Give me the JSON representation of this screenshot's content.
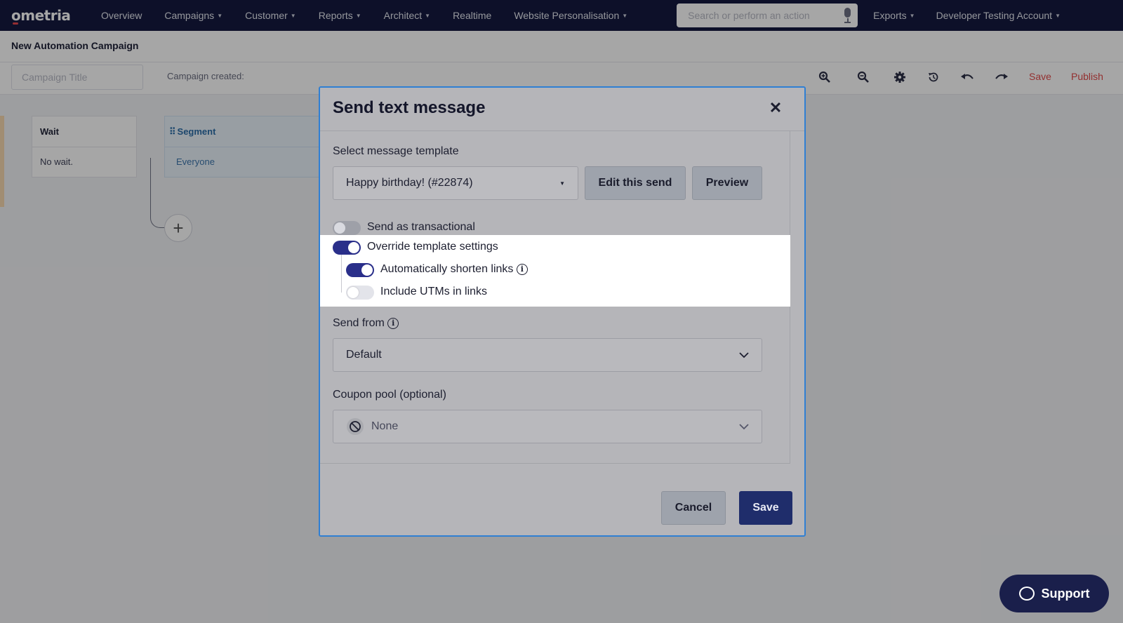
{
  "nav": {
    "logo": "ometria",
    "items": [
      {
        "label": "Overview",
        "caret": false
      },
      {
        "label": "Campaigns",
        "caret": true
      },
      {
        "label": "Customer",
        "caret": true
      },
      {
        "label": "Reports",
        "caret": true
      },
      {
        "label": "Architect",
        "caret": true
      },
      {
        "label": "Realtime",
        "caret": false
      },
      {
        "label": "Website Personalisation",
        "caret": true
      }
    ],
    "search_placeholder": "Search or perform an action",
    "right_items": [
      {
        "label": "Exports"
      },
      {
        "label": "Developer Testing Account"
      }
    ]
  },
  "page": {
    "title": "New Automation Campaign",
    "campaign_title_placeholder": "Campaign Title",
    "campaign_created": "Campaign created:",
    "save_label": "Save",
    "publish_label": "Publish"
  },
  "canvas": {
    "wait_node": {
      "title": "Wait",
      "body": "No wait."
    },
    "segment_node": {
      "title": "Segment",
      "body": "Everyone"
    },
    "add_symbol": "+"
  },
  "modal": {
    "title": "Send text message",
    "close_symbol": "✕",
    "template_label": "Select message template",
    "template_value": "Happy birthday! (#22874)",
    "edit_button": "Edit this send",
    "preview_button": "Preview",
    "toggles": {
      "transactional": {
        "label": "Send as transactional",
        "on": false
      },
      "override": {
        "label": "Override template settings",
        "on": true
      },
      "shorten": {
        "label": "Automatically shorten links",
        "on": true
      },
      "utm": {
        "label": "Include UTMs in links",
        "on": false
      }
    },
    "send_from_label": "Send from",
    "send_from_value": "Default",
    "coupon_label": "Coupon pool (optional)",
    "coupon_value": "None",
    "cancel_button": "Cancel",
    "save_button": "Save"
  },
  "support": {
    "label": "Support"
  },
  "colors": {
    "nav_bg": "#141a3f",
    "toggle_on": "#2a2f8a",
    "save_primary": "#1f2d6b",
    "accent_red": "#e24a4a",
    "modal_border": "#2f7fd3"
  }
}
